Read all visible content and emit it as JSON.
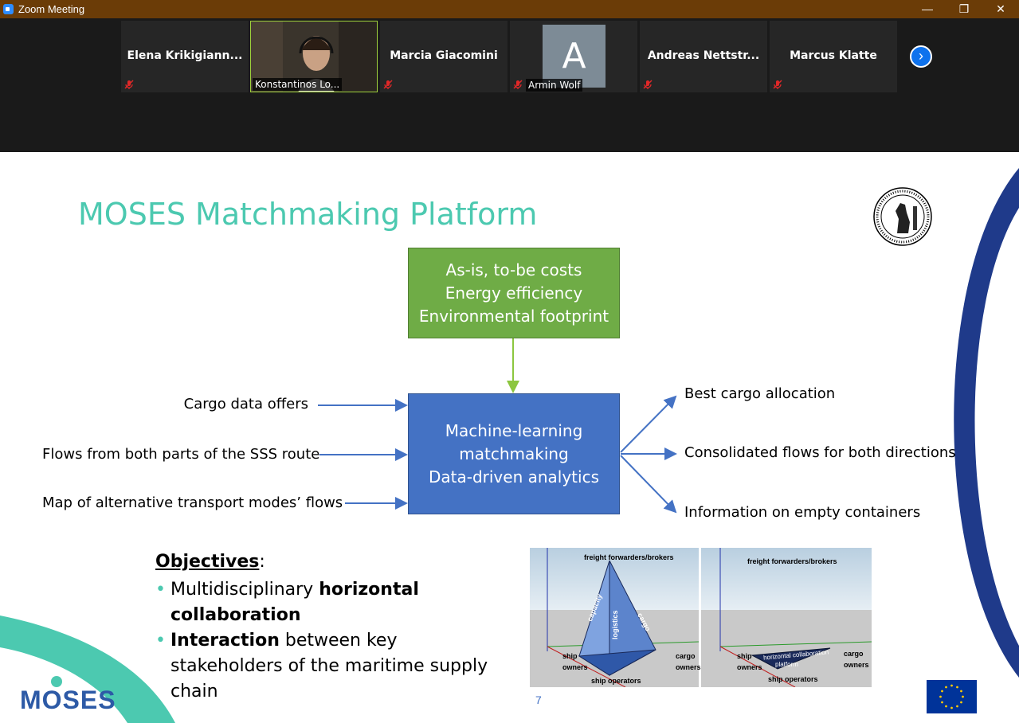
{
  "window": {
    "title": "Zoom Meeting"
  },
  "window_controls": {
    "minimize": "—",
    "restore": "❐",
    "close": "✕"
  },
  "participants": [
    {
      "name": "Elena  Krikigiann...",
      "muted": true
    },
    {
      "name": "Konstantinos Lo...",
      "muted": false,
      "video": true
    },
    {
      "name": "Marcia Giacomini",
      "muted": true
    },
    {
      "name": "Armin Wolf",
      "muted": true,
      "avatar_letter": "A"
    },
    {
      "name": "Andreas  Nettstr...",
      "muted": true
    },
    {
      "name": "Marcus Klatte",
      "muted": true
    }
  ],
  "gallery_next": {
    "icon": "chevron-right-icon",
    "glyph": "›"
  },
  "slide": {
    "title": "MOSES Matchmaking Platform",
    "top_box": [
      "As-is, to-be costs",
      "Energy efficiency",
      "Environmental footprint"
    ],
    "center_box": [
      "Machine-learning",
      "matchmaking",
      "Data-driven analytics"
    ],
    "inputs": [
      "Cargo data offers",
      "Flows from both parts of the SSS route",
      "Map of alternative transport modes’ flows"
    ],
    "outputs": [
      "Best cargo allocation",
      "Consolidated flows for both directions",
      "Information on empty containers"
    ],
    "objectives": {
      "heading": "Objectives",
      "colon": ":",
      "bullets": [
        {
          "pre": "Multidisciplinary ",
          "bold": "horizontal collaboration",
          "post": ""
        },
        {
          "pre": "",
          "bold": "Interaction",
          "post": " between key stakeholders of the maritime supply chain"
        }
      ]
    },
    "diagram_left": {
      "top": "freight forwarders/brokers",
      "ship_owners": [
        "ship",
        "owners"
      ],
      "cargo_owners": [
        "cargo",
        "owners"
      ],
      "bottom": "ship operators",
      "faces": [
        "capacity",
        "logistics",
        "cargo"
      ]
    },
    "diagram_right": {
      "top": "freight forwarders/brokers",
      "ship_owners": [
        "ship",
        "owners"
      ],
      "cargo_owners": [
        "cargo",
        "owners"
      ],
      "bottom": "ship operators",
      "platform": [
        "horizontal collaboration",
        "platform"
      ]
    },
    "page_number": "7",
    "logo_text": "MOSES",
    "colors": {
      "teal": "#4cc9b0",
      "green": "#6fac46",
      "blue": "#4472c4",
      "navy": "#1f3a8a"
    }
  }
}
